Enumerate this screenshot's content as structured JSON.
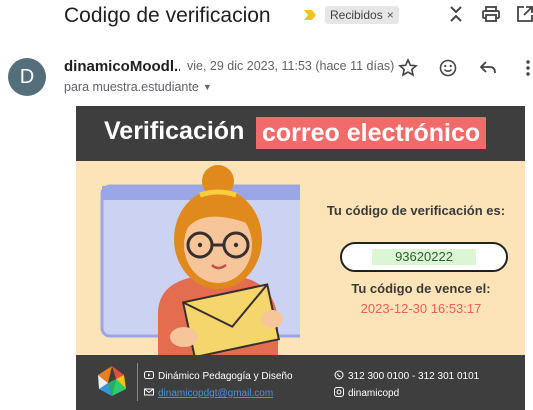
{
  "email": {
    "subject": "Codigo de verificacion",
    "label": "Recibidos",
    "label_remove": "×",
    "sender": {
      "initial": "D",
      "name": "dinamicoMoodl...",
      "date": "vie, 29 dic 2023, 11:53 (hace 11 días)",
      "recipient": "para muestra.estudiante"
    }
  },
  "icons": {
    "importance": "importance-marker-icon",
    "expand": "expand-collapse-icon",
    "print": "print-icon",
    "open_new": "open-in-new-window-icon",
    "star": "star-icon",
    "emoji": "emoji-reaction-icon",
    "reply": "reply-icon",
    "more": "more-options-icon"
  },
  "body": {
    "header_title": "Verificación",
    "header_highlight": "correo electrónico",
    "code_label": "Tu código de verificación es:",
    "code_value": "93620222",
    "expire_label": "Tu código de vence el:",
    "expire_value": "2023-12-30 16:53:17",
    "footer": {
      "org": "Dinámico Pedagogía y Diseño",
      "email": "dinamicopdgt@gmail.com",
      "phones": "312 300 0100 - 312 301 0101",
      "instagram": "dinamicopd"
    }
  },
  "colors": {
    "header_bg": "#3e3e3e",
    "highlight": "#f26b6b",
    "card_bg": "#fde4b8",
    "code_bg": "#dcf5d4",
    "expire_text": "#e5605e",
    "avatar_bg": "#546e7a"
  }
}
